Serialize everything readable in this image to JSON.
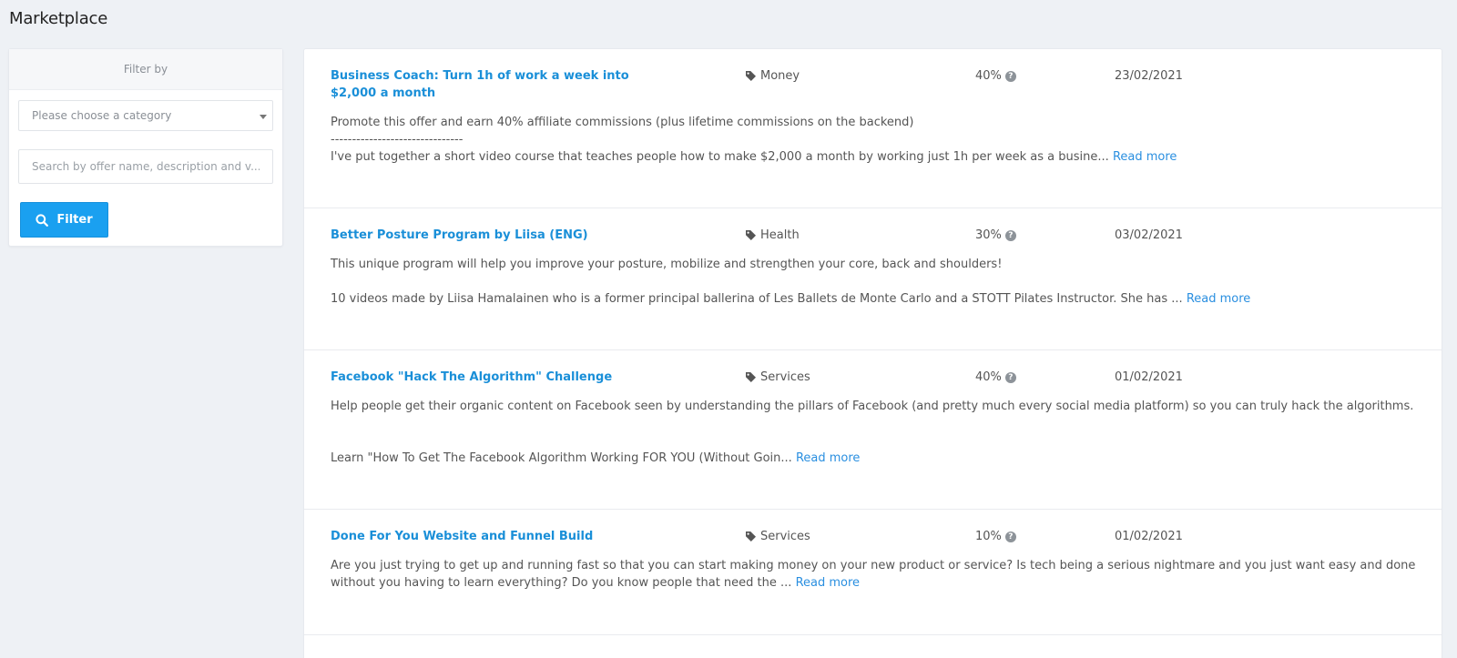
{
  "page": {
    "title": "Marketplace"
  },
  "filter": {
    "heading": "Filter by",
    "category_placeholder": "Please choose a category",
    "search_placeholder": "Search by offer name, description and v...",
    "button_label": "Filter"
  },
  "read_more_label": "Read more",
  "offers": [
    {
      "title": "Business Coach: Turn 1h of work a week into $2,000 a month",
      "category": "Money",
      "commission": "40%",
      "date": "23/02/2021",
      "desc_line1": "Promote this offer and earn 40% affiliate commissions (plus lifetime commissions on the backend)",
      "desc_line2": "-------------------------------",
      "desc_line3": "I've put together a short video course that teaches people how to make $2,000 a month by working just 1h per week as a busine..."
    },
    {
      "title": "Better Posture Program by Liisa (ENG)",
      "category": "Health",
      "commission": "30%",
      "date": "03/02/2021",
      "desc_line1": "This unique program will help you improve your posture, mobilize and strengthen your core, back and shoulders!",
      "desc_line2": "10 videos made by Liisa Hamalainen who is a former principal ballerina of Les Ballets de Monte Carlo and a STOTT Pilates Instructor. She has ..."
    },
    {
      "title": "Facebook \"Hack The Algorithm\" Challenge",
      "category": "Services",
      "commission": "40%",
      "date": "01/02/2021",
      "desc_line1": "Help people get their organic content on Facebook seen by understanding the pillars of Facebook (and pretty much every social media platform) so you can truly hack the algorithms.",
      "desc_line2": "Learn \"How To Get The Facebook Algorithm Working FOR YOU (Without Goin..."
    },
    {
      "title": "Done For You Website and Funnel Build",
      "category": "Services",
      "commission": "10%",
      "date": "01/02/2021",
      "desc_line1": "Are you just trying to get up and running fast so that you can start making money on your new product or service? Is tech being a serious nightmare and you just want easy and done",
      "desc_line2": "without you having to learn everything? Do you know people that need the ..."
    }
  ]
}
